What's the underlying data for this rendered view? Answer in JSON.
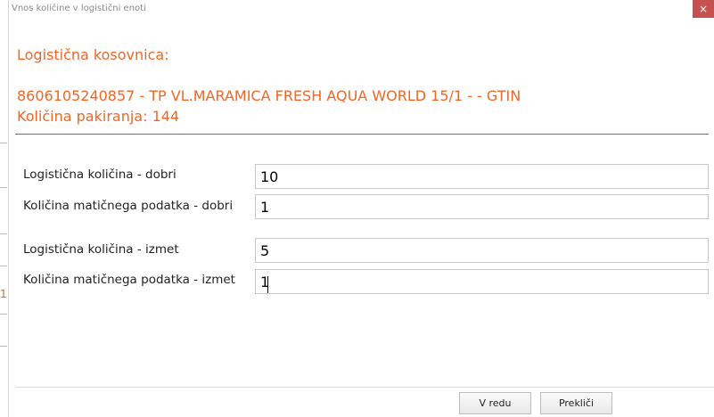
{
  "dialog": {
    "title": "Vnos količine v logistični enoti",
    "close_glyph": "×"
  },
  "header": {
    "label": "Logistična kosovnica:",
    "item": "8606105240857 - TP VL.MARAMICA FRESH AQUA WORLD 15/1 -  - GTIN",
    "pack_quantity": "Količina pakiranja: 144"
  },
  "form": {
    "rows": [
      {
        "label": "Logistična količina - dobri",
        "value": "10"
      },
      {
        "label": "Količina matičnega podatka - dobri",
        "value": "1"
      },
      {
        "label": "Logistična količina - izmet",
        "value": "5"
      },
      {
        "label": "Količina matičnega podatka - izmet",
        "value": "1"
      }
    ]
  },
  "buttons": {
    "ok_label": "V redu",
    "cancel_label": "Prekliči"
  },
  "background": {
    "orange_fragment": "1"
  },
  "colors": {
    "accent": "#f26522",
    "close_button": "#c75050"
  }
}
